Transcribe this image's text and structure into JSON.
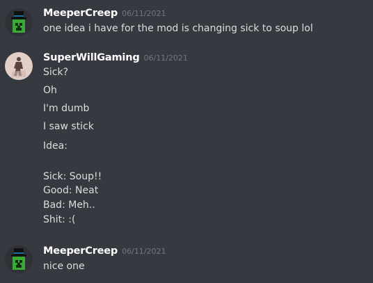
{
  "messages": [
    {
      "author": "MeeperCreep",
      "timestamp": "06/11/2021",
      "avatar_icon": "creeper-tophat-avatar",
      "lines": [
        "one idea i have for the mod is changing sick to soup lol"
      ]
    },
    {
      "author": "SuperWillGaming",
      "timestamp": "06/11/2021",
      "avatar_icon": "silhouette-avatar",
      "lines": [
        "Sick?",
        "Oh",
        "I'm dumb",
        "I saw stick",
        "Idea:",
        "",
        "Sick: Soup!!",
        "Good: Neat",
        "Bad: Meh..",
        "Shit: :("
      ]
    },
    {
      "author": "MeeperCreep",
      "timestamp": "06/11/2021",
      "avatar_icon": "creeper-tophat-avatar",
      "lines": [
        "nice one"
      ]
    }
  ],
  "colors": {
    "background": "#36393f",
    "username": "#ffffff",
    "text": "#dcddde",
    "timestamp": "#72767d"
  }
}
